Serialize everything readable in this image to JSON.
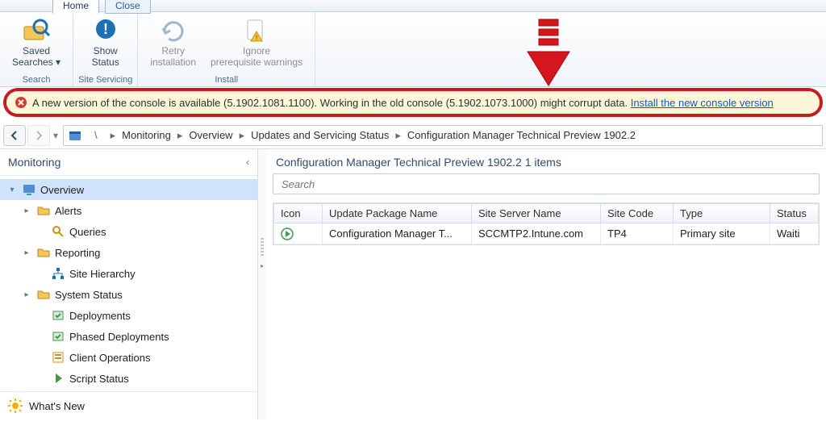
{
  "tabs": {
    "home": "Home",
    "close": "Close"
  },
  "ribbon": {
    "search": {
      "saved_searches": "Saved\nSearches ▾",
      "group": "Search"
    },
    "site": {
      "show_status": "Show\nStatus",
      "group": "Site Servicing"
    },
    "install": {
      "retry": "Retry\ninstallation",
      "ignore": "Ignore\nprerequisite warnings",
      "group": "Install"
    }
  },
  "notification": {
    "text": "A new version of the console is available (5.1902.1081.1100). Working in the old console (5.1902.1073.1000) might corrupt data. ",
    "link": "Install the new console version"
  },
  "breadcrumb": [
    "Monitoring",
    "Overview",
    "Updates and Servicing Status",
    "Configuration Manager Technical Preview 1902.2"
  ],
  "sidebar": {
    "title": "Monitoring",
    "items": [
      {
        "label": "Overview",
        "icon": "monitor",
        "selected": true,
        "level": 1,
        "expandable": true,
        "expanded": true
      },
      {
        "label": "Alerts",
        "icon": "folder",
        "level": 2,
        "expandable": true
      },
      {
        "label": "Queries",
        "icon": "query",
        "level": 3
      },
      {
        "label": "Reporting",
        "icon": "folder",
        "level": 2,
        "expandable": true
      },
      {
        "label": "Site Hierarchy",
        "icon": "hierarchy",
        "level": 3
      },
      {
        "label": "System Status",
        "icon": "folder",
        "level": 2,
        "expandable": true
      },
      {
        "label": "Deployments",
        "icon": "deploy",
        "level": 3
      },
      {
        "label": "Phased Deployments",
        "icon": "deploy",
        "level": 3
      },
      {
        "label": "Client Operations",
        "icon": "client",
        "level": 3
      },
      {
        "label": "Script Status",
        "icon": "script",
        "level": 3
      }
    ],
    "whats_new": "What's New"
  },
  "content": {
    "heading": "Configuration Manager Technical Preview 1902.2 1 items",
    "search_placeholder": "Search",
    "columns": [
      "Icon",
      "Update Package Name",
      "Site Server Name",
      "Site Code",
      "Type",
      "Status"
    ],
    "rows": [
      {
        "icon": "play",
        "upn": "Configuration Manager T...",
        "server": "SCCMTP2.Intune.com",
        "code": "TP4",
        "type": "Primary site",
        "status": "Waiti"
      }
    ]
  }
}
